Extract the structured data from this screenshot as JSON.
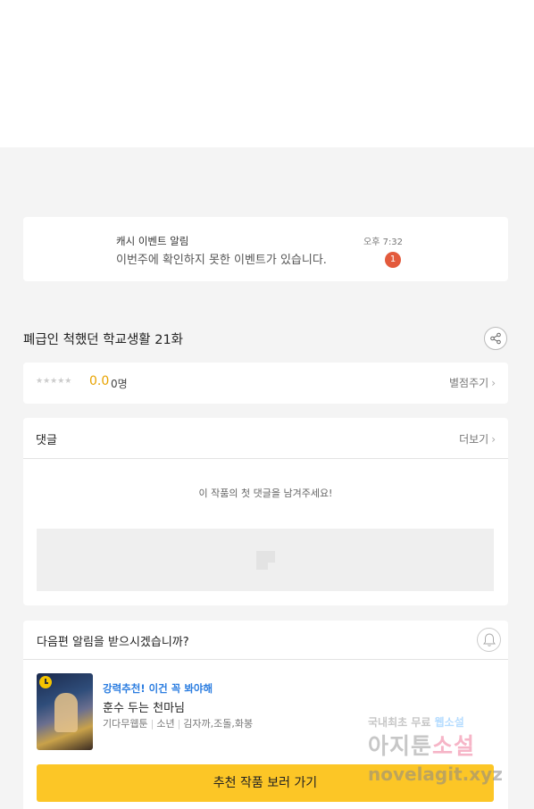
{
  "notification": {
    "title": "캐시 이벤트 알림",
    "message": "이번주에 확인하지 못한 이벤트가 있습니다.",
    "time": "오후 7:32",
    "badge_count": "1"
  },
  "episode": {
    "title": "폐급인 척했던 학교생활 21화",
    "share_icon": "share-icon"
  },
  "rating": {
    "stars": "★★★★★",
    "score": "0.0",
    "count": "0명",
    "rate_label": "별점주기"
  },
  "comments": {
    "label": "댓글",
    "more_label": "더보기",
    "empty_message": "이 작품의 첫 댓글을 남겨주세요!"
  },
  "next_episode": {
    "question": "다음편 알림을 받으시겠습니까?",
    "bell_icon": "bell-icon"
  },
  "recommendation": {
    "tag": "강력추천! 이건 꼭 봐야해",
    "title": "훈수 두는 천마님",
    "meta": [
      "기다무웹툰",
      "소년",
      "김자까,조돌,화봉"
    ],
    "button_label": "추천 작품 보러 가기"
  },
  "watermark": {
    "line1_a": "국내최초 무료",
    "line1_b": "웹소설",
    "line2_a": "아지툰",
    "line2_b": "소설",
    "line3": "novelagit.xyz"
  },
  "colors": {
    "accent_yellow": "#fcc626",
    "score_orange": "#e8a300",
    "badge_red": "#e35a3c",
    "tag_blue": "#2b7de0"
  }
}
